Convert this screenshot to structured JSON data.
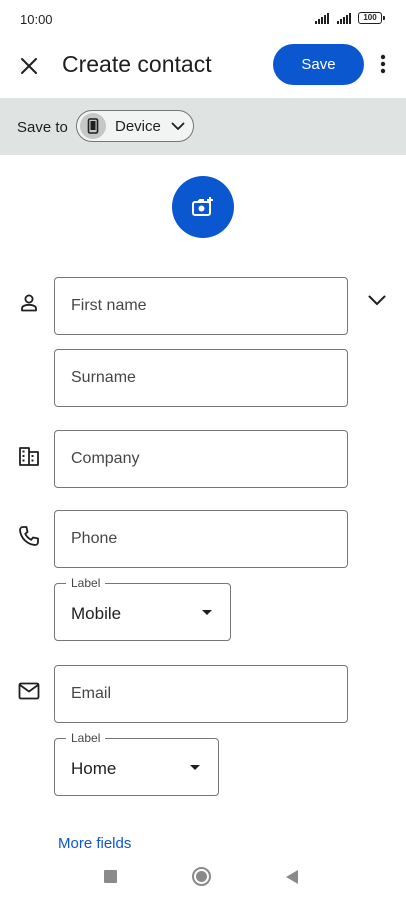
{
  "status_bar": {
    "time": "10:00",
    "battery": "100",
    "icons": [
      "signal-icon",
      "signal-icon",
      "battery-icon"
    ]
  },
  "app_bar": {
    "close_icon": "close-icon",
    "title": "Create contact",
    "save_label": "Save",
    "more_icon": "more-vert-icon"
  },
  "save_to": {
    "label": "Save to",
    "account": "Device",
    "account_icon": "phone-device-icon",
    "dropdown_icon": "chevron-down-icon"
  },
  "photo": {
    "icon": "add-photo-icon"
  },
  "fields": {
    "first_name": {
      "placeholder": "First name",
      "icon": "person-icon"
    },
    "surname": {
      "placeholder": "Surname"
    },
    "company": {
      "placeholder": "Company",
      "icon": "business-icon"
    },
    "phone": {
      "placeholder": "Phone",
      "icon": "phone-icon",
      "label_caption": "Label",
      "label_value": "Mobile"
    },
    "email": {
      "placeholder": "Email",
      "icon": "email-icon",
      "label_caption": "Label",
      "label_value": "Home"
    }
  },
  "expand_icon": "chevron-down-icon",
  "more_fields": "More fields",
  "colors": {
    "accent": "#0b57d0",
    "save_to_bar": "#dfe3e1",
    "outline": "#747775",
    "text": "#1f1f1f"
  },
  "nav_bar": {
    "icons": [
      "recents-icon",
      "home-icon",
      "back-icon"
    ]
  }
}
